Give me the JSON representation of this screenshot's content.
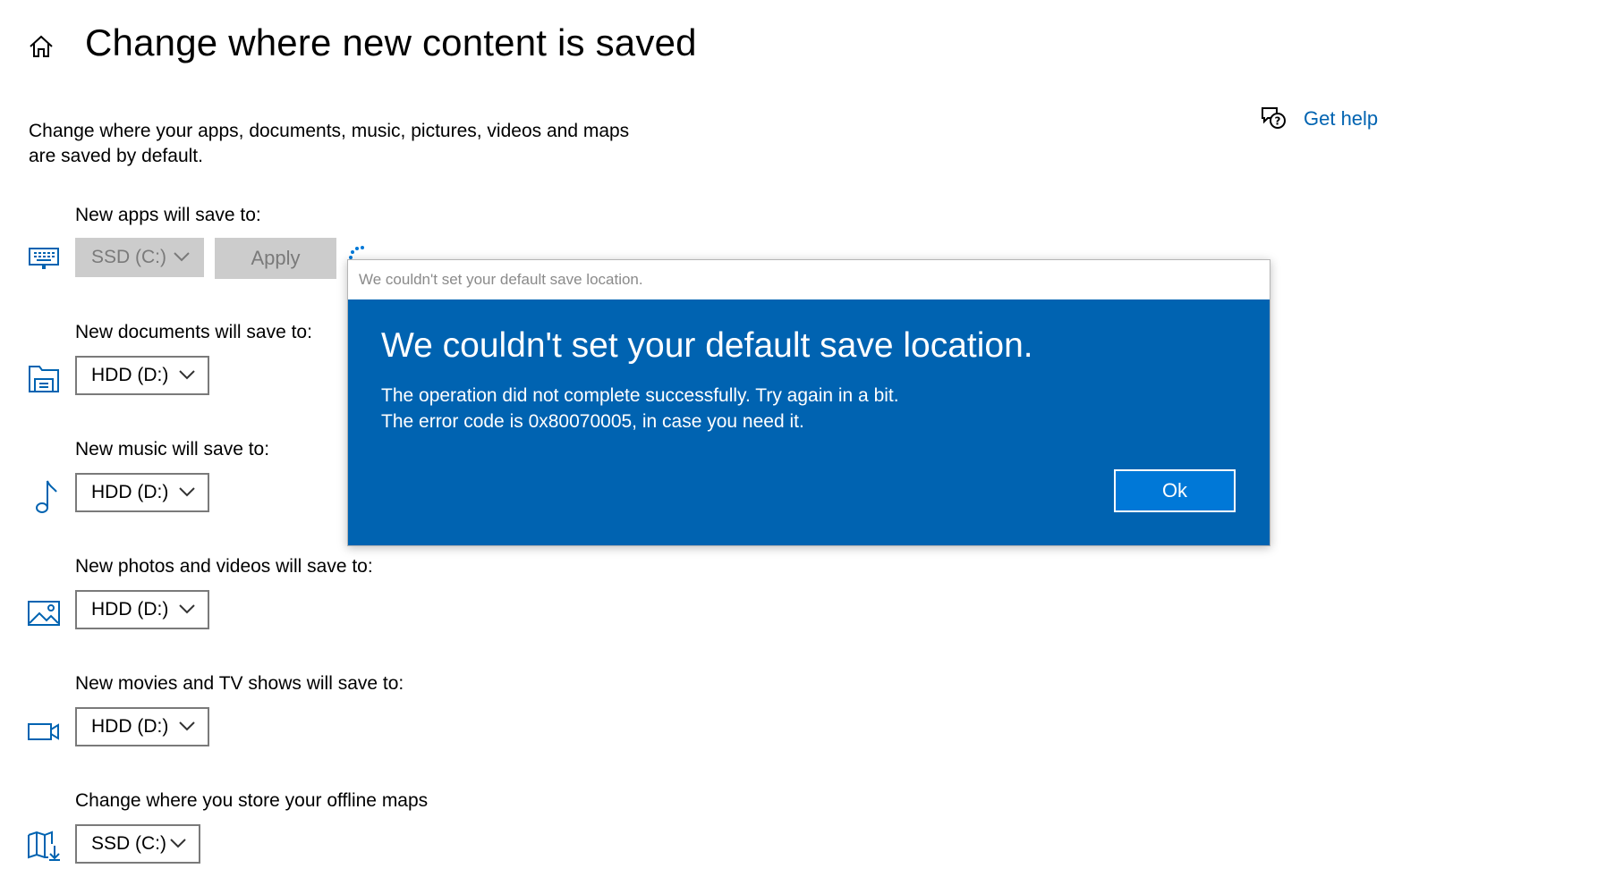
{
  "header": {
    "title": "Change where new content is saved",
    "home_icon": "home-icon"
  },
  "description": {
    "line1": "Change where your apps, documents, music, pictures, videos and maps",
    "line2": "are saved by default."
  },
  "help": {
    "label": "Get help",
    "icon": "chat-help-icon",
    "color": "#0063b1"
  },
  "rows": [
    {
      "label": "New apps will save to:",
      "icon": "keyboard-icon",
      "value": "SSD (C:)",
      "disabled": true
    },
    {
      "label": "New documents will save to:",
      "icon": "folder-icon",
      "value": "HDD (D:)"
    },
    {
      "label": "New music will save to:",
      "icon": "music-note-icon",
      "value": "HDD (D:)"
    },
    {
      "label": "New photos and videos will save to:",
      "icon": "picture-icon",
      "value": "HDD (D:)"
    },
    {
      "label": "New movies and TV shows will save to:",
      "icon": "video-camera-icon",
      "value": "HDD (D:)"
    },
    {
      "label": "Change where you store your offline maps",
      "icon": "map-download-icon",
      "value": "SSD (C:)"
    }
  ],
  "apply_label": "Apply",
  "dialog": {
    "window_title": "We couldn't set your default save location.",
    "heading": "We couldn't set your default save location.",
    "message_line1": "The operation did not complete successfully. Try again in a bit.",
    "message_line2": "The error code is 0x80070005, in case you need it.",
    "ok_label": "Ok",
    "background_color": "#0063b1"
  },
  "colors": {
    "accent": "#0078d7",
    "icon_blue": "#0063b1",
    "disabled_gray": "#cccccc"
  }
}
